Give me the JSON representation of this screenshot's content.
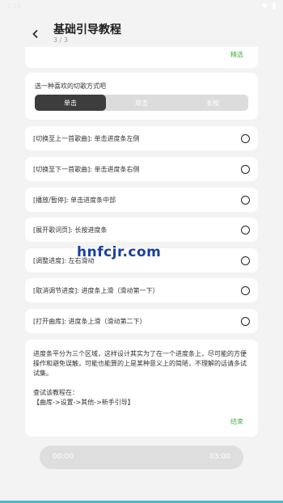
{
  "status": {
    "time": "3:14",
    "extra": "13"
  },
  "header": {
    "title": "基础引导教程",
    "subtitle": "3 / 3"
  },
  "top_card": {
    "link": "精选"
  },
  "mode": {
    "title": "选一种喜欢的切歌方式吧",
    "options": [
      "单击",
      "双击",
      "长按"
    ],
    "selected_index": 0
  },
  "actions": [
    "[切换至上一首歌曲]: 单击进度条左侧",
    "[切换至下一首歌曲]: 单击进度条右侧",
    "[播放/暂停]: 单击进度条中部",
    "[展开歌词页]: 长按进度条",
    "[调整进度]: 左右滑动",
    "[取消调节进度]: 进度条上滑（滑动第一下）",
    "[打开曲库]: 进度条上滑（滑动第二下）"
  ],
  "info": {
    "paragraph": "进度条平分为三个区域，这样设计其实为了在一个进度条上，尽可能的方便操作和避免误触，可能也能算的上是某种意义上的简陋，不理解的话请多试试集。",
    "hint_line1": "查试该教程在：",
    "hint_line2": "【曲库->设置->其他->新手引导】",
    "done_label": "结束"
  },
  "player": {
    "elapsed": "00:00",
    "total": "03:00"
  },
  "watermark": "hnfcjr.com",
  "colors": {
    "accent_green": "#4caf50",
    "segment_active": "#3d3d3d"
  }
}
